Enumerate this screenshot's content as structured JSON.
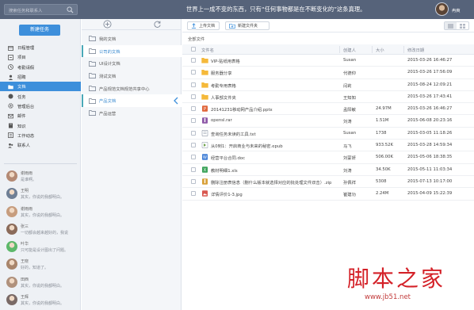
{
  "topbar": {
    "search_placeholder": "搜索任务和联系人",
    "motto": "世界上一成不变的东西，只有“任何事物都是在不断变化的”这条真理。",
    "username": "冉爽"
  },
  "leftnav": {
    "new_task_label": "新建任务",
    "items": [
      {
        "label": "日程管理",
        "icon": "calendar-icon"
      },
      {
        "label": "项目",
        "icon": "project-icon"
      },
      {
        "label": "考勤请假",
        "icon": "clock-icon"
      },
      {
        "label": "招聘",
        "icon": "person-icon"
      },
      {
        "label": "文档",
        "icon": "folder-icon",
        "active": true
      },
      {
        "label": "任务",
        "icon": "task-icon"
      },
      {
        "label": "管理后台",
        "icon": "gear-icon"
      },
      {
        "label": "邮件",
        "icon": "mail-icon"
      },
      {
        "label": "知识",
        "icon": "book-icon"
      },
      {
        "label": "工作动态",
        "icon": "activity-icon"
      },
      {
        "label": "联系人",
        "icon": "contacts-icon"
      }
    ],
    "chats": [
      {
        "name": "谢雨雨",
        "message": "是谁啊。",
        "avatar_color": "#b48a74"
      },
      {
        "name": "王明",
        "message": "其实，你说的我都明白。",
        "avatar_color": "#6f7f95"
      },
      {
        "name": "谢雨雨",
        "message": "其实，你说的我都明白。",
        "avatar_color": "#c79d7e"
      },
      {
        "name": "张三",
        "message": "一切都会越来越好的，我说",
        "avatar_color": "#8b6b5a"
      },
      {
        "name": "叶华",
        "message": "只可能是设计图出了问题。",
        "avatar_color": "#5db86a"
      },
      {
        "name": "王晓",
        "message": "好的，知道了。",
        "avatar_color": "#a9856b"
      },
      {
        "name": "田西",
        "message": "其实，你说的我都明白。",
        "avatar_color": "#b0917c"
      },
      {
        "name": "王辉",
        "message": "其实，你说的我都明白。",
        "avatar_color": "#7a6a66"
      }
    ]
  },
  "folderpanel": {
    "add_icon": "plus-circle-icon",
    "refresh_icon": "refresh-icon",
    "folders": [
      {
        "label": "我的文档"
      },
      {
        "label": "公司的文档",
        "active": true
      },
      {
        "label": "UI设计文档"
      },
      {
        "label": "测试文档"
      },
      {
        "label": "产品规范文档规范共享中心"
      },
      {
        "label": "产品文档",
        "active": true
      },
      {
        "label": "产品运营"
      }
    ]
  },
  "main": {
    "upload_label": "上传文档",
    "newfolder_label": "新建文件夹",
    "breadcrumb": "全部文件",
    "columns": {
      "name": "文件名",
      "creator": "创建人",
      "size": "大小",
      "date": "修改日期"
    },
    "files": [
      {
        "name": "VIP-贴纸用表格",
        "creator": "Susan",
        "size": "",
        "date": "2015-03-26 16:46:27",
        "type": "folder"
      },
      {
        "name": "服务器分享",
        "creator": "代德仰",
        "size": "",
        "date": "2015-03-26 17:56:09",
        "type": "folder"
      },
      {
        "name": "考勤专用表格",
        "creator": "闫莉",
        "size": "",
        "date": "2015-08-24 12:09:21",
        "type": "folder"
      },
      {
        "name": "人事部文件夹",
        "creator": "王知知",
        "size": "",
        "date": "2015-03-26 17:43:41",
        "type": "folder"
      },
      {
        "name": "20141231移动网产品介绍.pptx",
        "creator": "孟阳敏",
        "size": "24.97M",
        "date": "2015-03-26 16:46:27",
        "type": "ppt"
      },
      {
        "name": "opensl.rar",
        "creator": "刘涛",
        "size": "1.51M",
        "date": "2015-06-08 20:23:16",
        "type": "rar"
      },
      {
        "name": "查询任务未读的工具.txt",
        "creator": "Susan",
        "size": "1738",
        "date": "2015-03-05 11:18:26",
        "type": "txt"
      },
      {
        "name": "从0到1：开启商业与未来的秘密.epub",
        "creator": "马飞",
        "size": "933.52K",
        "date": "2015-03-28 14:59:34",
        "type": "epub"
      },
      {
        "name": "经营平台合同.doc",
        "creator": "刘蒙妍",
        "size": "506.00K",
        "date": "2015-05-06 18:38:35",
        "type": "doc"
      },
      {
        "name": "教材明细1.xls",
        "creator": "刘涛",
        "size": "34.50K",
        "date": "2015-05-11 11:03:34",
        "type": "xls"
      },
      {
        "name": "删除注册表信息（删什么版本就选择对应的批处理文件双击）.zip",
        "creator": "孙佩祥",
        "size": "5308",
        "date": "2015-07-13 10:17:00",
        "type": "zip"
      },
      {
        "name": "详情评价1-3.jpg",
        "creator": "崔建功",
        "size": "2.24M",
        "date": "2015-04-09 15:22:39",
        "type": "jpg"
      }
    ]
  },
  "watermark": {
    "logo": "脚本之家",
    "url": "www.jb51.net"
  },
  "colors": {
    "topbar": "#56637a",
    "accent": "#3d8fdb",
    "folder": "#f5b93a",
    "watermark": "#d42128"
  }
}
